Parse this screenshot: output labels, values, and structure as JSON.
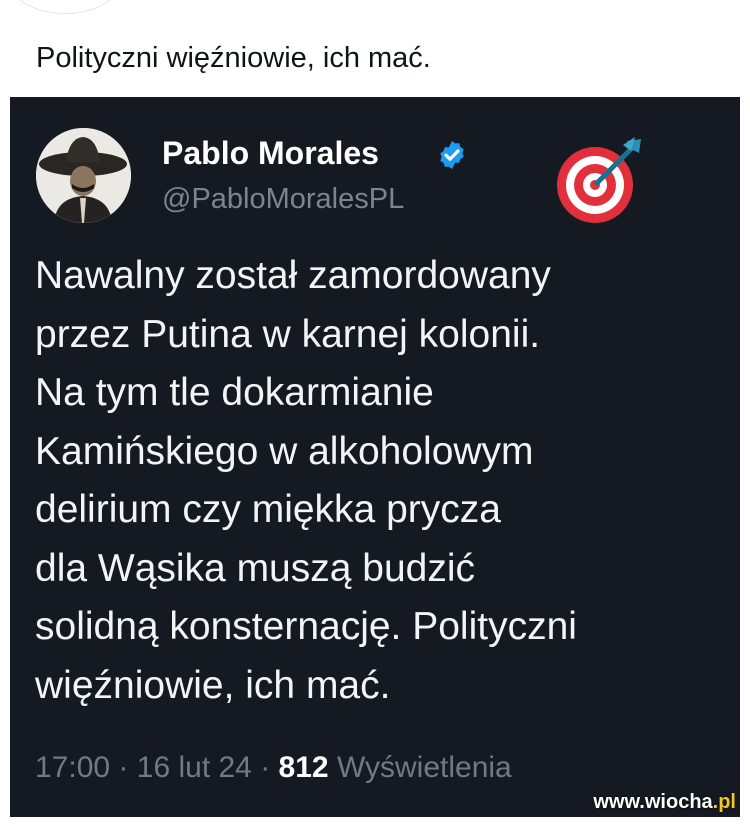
{
  "caption": "Polityczni więźniowie, ich mać.",
  "post": {
    "author_name": "Pablo Morales",
    "author_handle": "@PabloMoralesPL",
    "verified": true,
    "author_badge_icon": "direct-hit-target-emoji",
    "text_lines": [
      "Nawalny został zamordowany",
      "przez Putina w karnej kolonii.",
      "Na tym tle dokarmianie",
      "Kamińskiego w alkoholowym",
      "delirium czy miękka prycza",
      "dla Wąsika muszą budzić",
      "solidną konsternację. Polityczni",
      "więźniowie, ich mać."
    ],
    "time": "17:00",
    "date": "16 lut 24",
    "separator": "·",
    "views_count": "812",
    "views_label": "Wyświetlenia"
  },
  "watermark": {
    "domain": "www.wiocha",
    "tld": ".pl"
  },
  "colors": {
    "card_bg": "#151a22",
    "verified_blue": "#1d9bf0",
    "muted_text": "#6f7a86"
  }
}
